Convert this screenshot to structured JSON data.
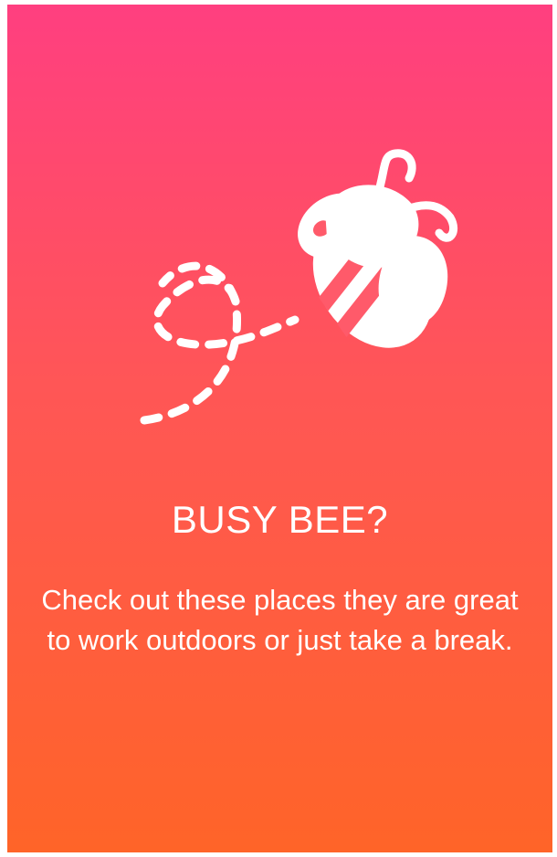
{
  "screen": {
    "title": "BUSY BEE?",
    "description": "Check out these places they are great to work outdoors or just take a break.",
    "gradient": {
      "top": "#ff3f80",
      "middle": "#ff5656",
      "bottom": "#ff6428"
    },
    "illustration_icon": "bee-icon"
  }
}
